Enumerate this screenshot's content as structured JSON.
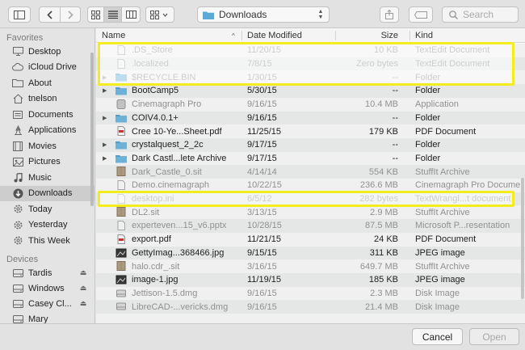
{
  "toolbar": {
    "location": "Downloads",
    "search_placeholder": "Search"
  },
  "sidebar": {
    "favorites_label": "Favorites",
    "favorites": [
      {
        "label": "Desktop",
        "icon": "desktop-icon"
      },
      {
        "label": "iCloud Drive",
        "icon": "cloud-icon"
      },
      {
        "label": "About",
        "icon": "folder-icon"
      },
      {
        "label": "tnelson",
        "icon": "home-icon"
      },
      {
        "label": "Documents",
        "icon": "documents-icon"
      },
      {
        "label": "Applications",
        "icon": "applications-icon"
      },
      {
        "label": "Movies",
        "icon": "movies-icon"
      },
      {
        "label": "Pictures",
        "icon": "pictures-icon"
      },
      {
        "label": "Music",
        "icon": "music-icon"
      },
      {
        "label": "Downloads",
        "icon": "downloads-icon",
        "selected": true
      },
      {
        "label": "Today",
        "icon": "gear-icon"
      },
      {
        "label": "Yesterday",
        "icon": "gear-icon"
      },
      {
        "label": "This Week",
        "icon": "gear-icon"
      }
    ],
    "devices_label": "Devices",
    "devices": [
      {
        "label": "Tardis",
        "icon": "drive-icon"
      },
      {
        "label": "Windows",
        "icon": "drive-icon"
      },
      {
        "label": "Casey Cl...",
        "icon": "drive-icon"
      },
      {
        "label": "Mary",
        "icon": "drive-icon"
      }
    ]
  },
  "columns": {
    "name": "Name",
    "date": "Date Modified",
    "size": "Size",
    "kind": "Kind"
  },
  "files": [
    {
      "name": ".DS_Store",
      "date": "11/20/15",
      "size": "10 KB",
      "kind": "TextEdit Document",
      "type": "doc",
      "hidden": true
    },
    {
      "name": ".localized",
      "date": "7/8/15",
      "size": "Zero bytes",
      "kind": "TextEdit Document",
      "type": "doc",
      "hidden": true
    },
    {
      "name": "$RECYCLE.BIN",
      "date": "1/30/15",
      "size": "--",
      "kind": "Folder",
      "type": "folder",
      "hidden": true,
      "expandable": true
    },
    {
      "name": "BootCamp5",
      "date": "5/30/15",
      "size": "--",
      "kind": "Folder",
      "type": "folder",
      "expandable": true
    },
    {
      "name": "Cinemagraph Pro",
      "date": "9/16/15",
      "size": "10.4 MB",
      "kind": "Application",
      "type": "app",
      "dim": true
    },
    {
      "name": "COIV4.0.1+",
      "date": "9/16/15",
      "size": "--",
      "kind": "Folder",
      "type": "folder",
      "expandable": true
    },
    {
      "name": "Cree 10-Ye...Sheet.pdf",
      "date": "11/25/15",
      "size": "179 KB",
      "kind": "PDF Document",
      "type": "pdf"
    },
    {
      "name": "crystalquest_2_2c",
      "date": "9/17/15",
      "size": "--",
      "kind": "Folder",
      "type": "folder",
      "expandable": true
    },
    {
      "name": "Dark Castl...lete Archive",
      "date": "9/17/15",
      "size": "--",
      "kind": "Folder",
      "type": "folder",
      "expandable": true
    },
    {
      "name": "Dark_Castle_0.sit",
      "date": "4/14/14",
      "size": "554 KB",
      "kind": "StuffIt Archive",
      "type": "archive",
      "dim": true
    },
    {
      "name": "Demo.cinemagraph",
      "date": "10/22/15",
      "size": "236.6 MB",
      "kind": "Cinemagraph Pro Document",
      "type": "doc",
      "dim": true
    },
    {
      "name": "desktop.ini",
      "date": "6/5/12",
      "size": "282 bytes",
      "kind": "TextWrangl...t document",
      "type": "doc",
      "hidden": true
    },
    {
      "name": "DL2.sit",
      "date": "3/13/15",
      "size": "2.9 MB",
      "kind": "StuffIt Archive",
      "type": "archive",
      "dim": true
    },
    {
      "name": "experteven...15_v6.pptx",
      "date": "10/28/15",
      "size": "87.5 MB",
      "kind": "Microsoft P...resentation",
      "type": "doc",
      "dim": true
    },
    {
      "name": "export.pdf",
      "date": "11/21/15",
      "size": "24 KB",
      "kind": "PDF Document",
      "type": "pdf"
    },
    {
      "name": "GettyImag...368466.jpg",
      "date": "9/15/15",
      "size": "311 KB",
      "kind": "JPEG image",
      "type": "image"
    },
    {
      "name": "halo.cdr_.sit",
      "date": "3/16/15",
      "size": "649.7 MB",
      "kind": "StuffIt Archive",
      "type": "archive",
      "dim": true
    },
    {
      "name": "image-1.jpg",
      "date": "11/19/15",
      "size": "185 KB",
      "kind": "JPEG image",
      "type": "image"
    },
    {
      "name": "Jettison-1.5.dmg",
      "date": "9/16/15",
      "size": "2.3 MB",
      "kind": "Disk Image",
      "type": "disk",
      "dim": true
    },
    {
      "name": "LibreCAD-...vericks.dmg",
      "date": "9/16/15",
      "size": "21.4 MB",
      "kind": "Disk Image",
      "type": "disk",
      "dim": true
    }
  ],
  "buttons": {
    "cancel": "Cancel",
    "open": "Open"
  },
  "colors": {
    "folder": "#5aa9d6",
    "highlight": "#f3ec1e"
  }
}
